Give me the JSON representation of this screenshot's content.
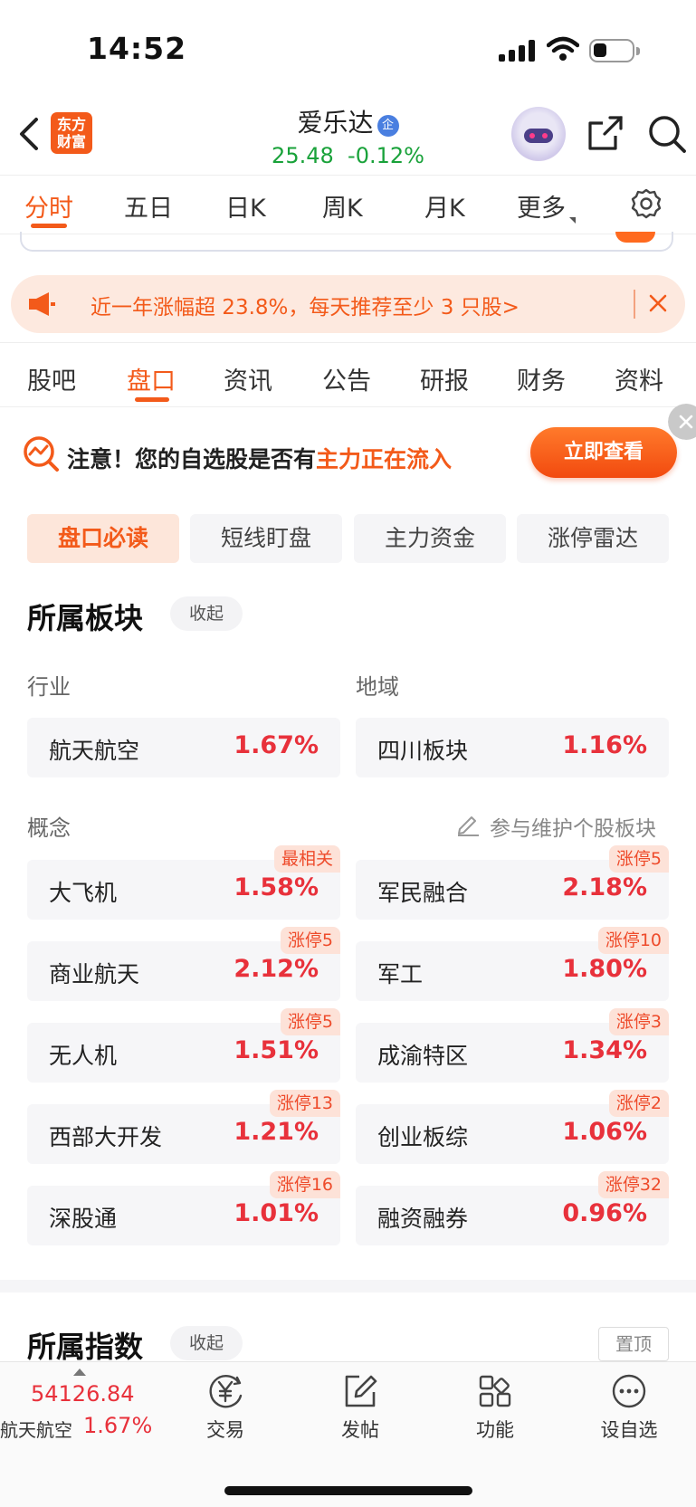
{
  "status_bar": {
    "time": "14:52"
  },
  "header": {
    "logo_text_line1": "东方",
    "logo_text_line2": "财富",
    "stock_name": "爱乐达",
    "verify_badge": "企",
    "price": "25.48",
    "change_pct": "-0.12%"
  },
  "period_tabs": [
    "分时",
    "五日",
    "日K",
    "周K",
    "月K",
    "更多"
  ],
  "promo": {
    "text": "近一年涨幅超 23.8%，每天推荐至少 3 只股>"
  },
  "main_tabs": [
    "股吧",
    "盘口",
    "资讯",
    "公告",
    "研报",
    "财务",
    "资料"
  ],
  "notice": {
    "prefix": "注意！您的自选股是否有",
    "highlight": "主力正在流入",
    "button": "立即查看"
  },
  "sub_tabs": [
    "盘口必读",
    "短线盯盘",
    "主力资金",
    "涨停雷达"
  ],
  "sector_section": {
    "title": "所属板块",
    "collapse_label": "收起",
    "industry_label": "行业",
    "region_label": "地域",
    "industry": {
      "name": "航天航空",
      "pct": "1.67%"
    },
    "region": {
      "name": "四川板块",
      "pct": "1.16%"
    },
    "concept_label": "概念",
    "maintain_link": "参与维护个股板块",
    "concepts": [
      {
        "name": "大飞机",
        "pct": "1.58%",
        "tag": "最相关"
      },
      {
        "name": "军民融合",
        "pct": "2.18%",
        "tag": "涨停5"
      },
      {
        "name": "商业航天",
        "pct": "2.12%",
        "tag": "涨停5"
      },
      {
        "name": "军工",
        "pct": "1.80%",
        "tag": "涨停10"
      },
      {
        "name": "无人机",
        "pct": "1.51%",
        "tag": "涨停5"
      },
      {
        "name": "成渝特区",
        "pct": "1.34%",
        "tag": "涨停3"
      },
      {
        "name": "西部大开发",
        "pct": "1.21%",
        "tag": "涨停13"
      },
      {
        "name": "创业板综",
        "pct": "1.06%",
        "tag": "涨停2"
      },
      {
        "name": "深股通",
        "pct": "1.01%",
        "tag": "涨停16"
      },
      {
        "name": "融资融券",
        "pct": "0.96%",
        "tag": "涨停32"
      }
    ]
  },
  "index_section": {
    "title": "所属指数",
    "collapse_label": "收起",
    "pin_label": "置顶"
  },
  "bottom_bar": {
    "index_value": "54126.84",
    "index_name": "航天航空",
    "index_pct": "1.67%",
    "nav": [
      "交易",
      "发帖",
      "功能",
      "设自选"
    ]
  },
  "colors": {
    "accent": "#f35a1a",
    "up": "#e8313b",
    "down": "#19a23a"
  }
}
